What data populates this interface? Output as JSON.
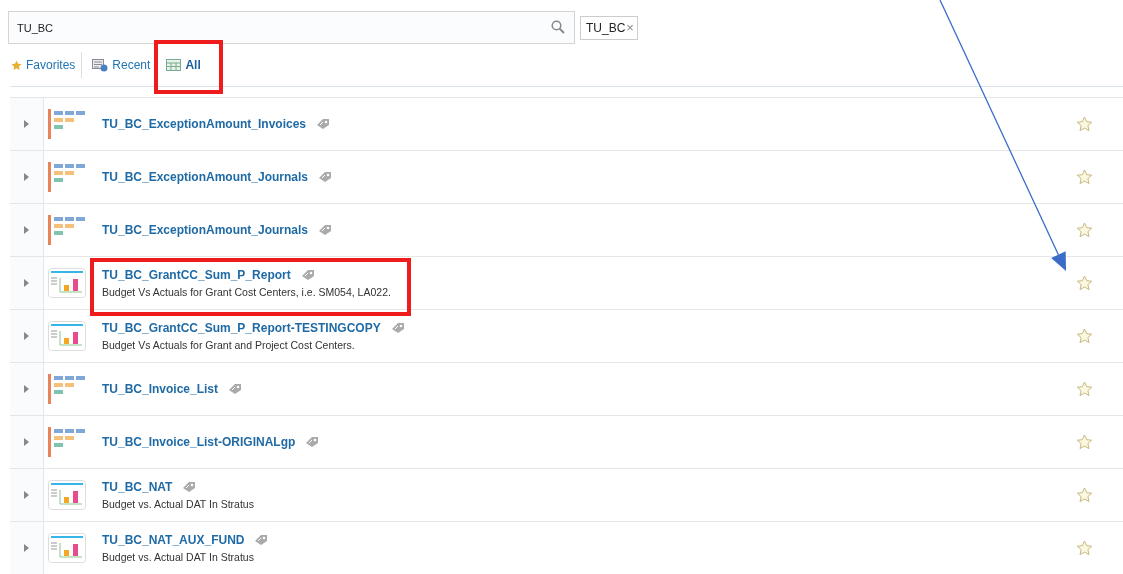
{
  "search": {
    "value": "TU_BC"
  },
  "filter_chip": {
    "label": "TU_BC",
    "remove": "×"
  },
  "tabs": [
    {
      "label": "Favorites",
      "kind": "favorites",
      "selected": false,
      "highlighted": false
    },
    {
      "label": "Recent",
      "kind": "recent",
      "selected": false,
      "highlighted": false
    },
    {
      "label": "All",
      "kind": "all",
      "selected": true,
      "highlighted": true
    }
  ],
  "rows": [
    {
      "kind": "list",
      "name": "TU_BC_ExceptionAmount_Invoices",
      "favorite": false,
      "highlighted": false,
      "arrow": false
    },
    {
      "kind": "list",
      "name": "TU_BC_ExceptionAmount_Journals",
      "favorite": false,
      "highlighted": false,
      "arrow": false
    },
    {
      "kind": "list",
      "name": "TU_BC_ExceptionAmount_Journals",
      "favorite": false,
      "highlighted": false,
      "arrow": false
    },
    {
      "kind": "report",
      "name": "TU_BC_GrantCC_Sum_P_Report",
      "description": "Budget Vs Actuals for Grant Cost Centers, i.e. SM054, LA022.",
      "favorite": false,
      "highlighted": true,
      "arrow": true
    },
    {
      "kind": "report",
      "name": "TU_BC_GrantCC_Sum_P_Report-TESTINGCOPY",
      "description": "Budget Vs Actuals for Grant and Project Cost Centers.",
      "favorite": false,
      "highlighted": false,
      "arrow": false
    },
    {
      "kind": "list",
      "name": "TU_BC_Invoice_List",
      "favorite": false,
      "highlighted": false,
      "arrow": false
    },
    {
      "kind": "list",
      "name": "TU_BC_Invoice_List-ORIGINALgp",
      "favorite": false,
      "highlighted": false,
      "arrow": false
    },
    {
      "kind": "report",
      "name": "TU_BC_NAT",
      "description": "Budget vs. Actual DAT In Stratus",
      "favorite": false,
      "highlighted": false,
      "arrow": false
    },
    {
      "kind": "report",
      "name": "TU_BC_NAT_AUX_FUND",
      "description": "Budget vs. Actual DAT In Stratus",
      "favorite": false,
      "highlighted": false,
      "arrow": false
    }
  ]
}
